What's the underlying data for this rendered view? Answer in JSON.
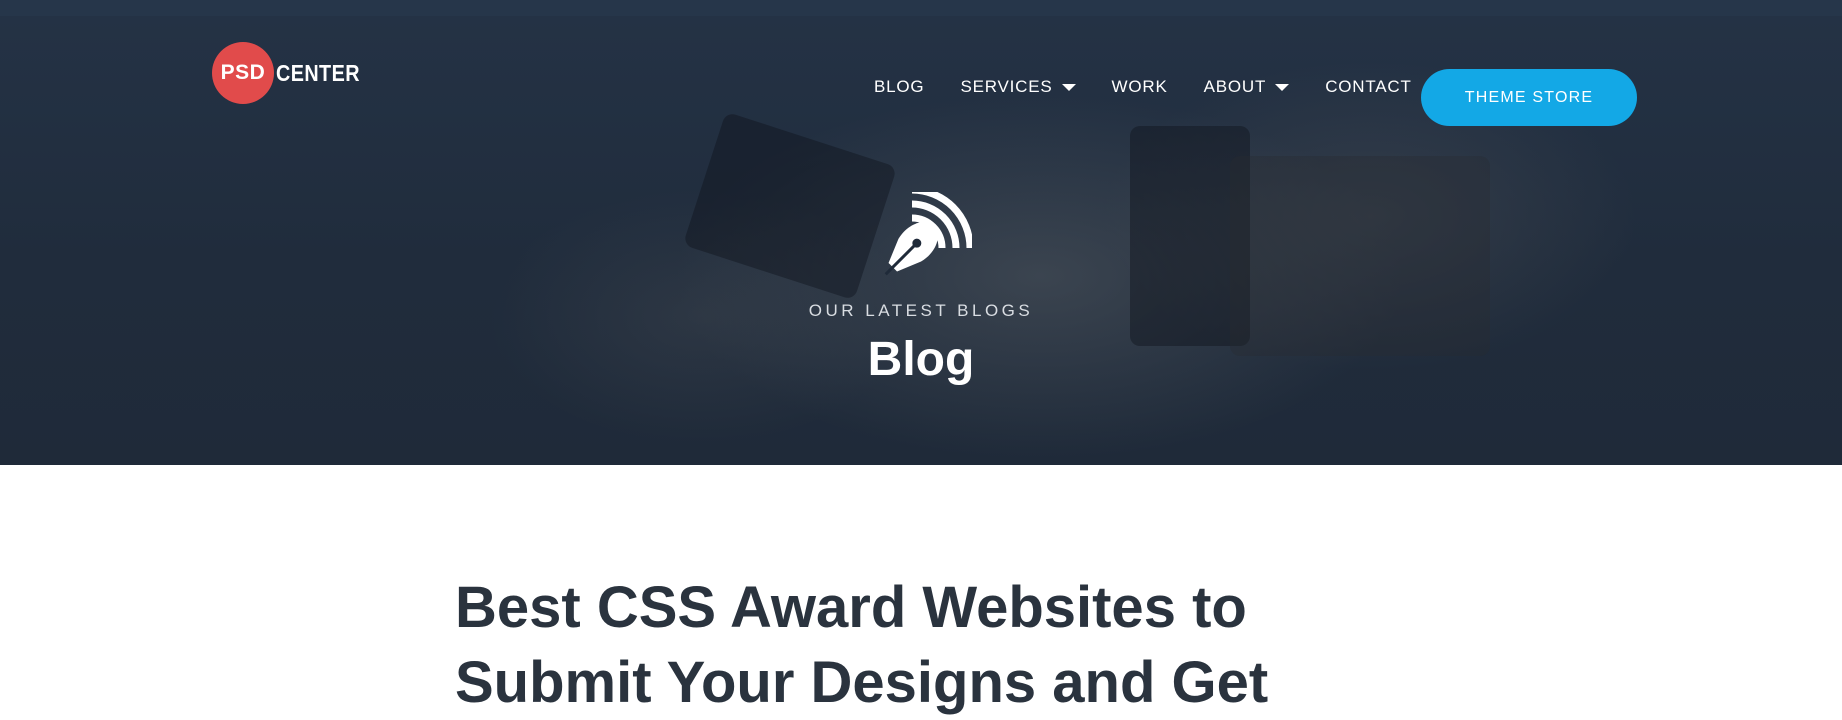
{
  "logo": {
    "badge_text": "PSD",
    "text": "CENTER",
    "badge_color": "#e14b4b"
  },
  "nav": {
    "items": [
      {
        "label": "BLOG",
        "has_dropdown": false
      },
      {
        "label": "SERVICES",
        "has_dropdown": true
      },
      {
        "label": "WORK",
        "has_dropdown": false
      },
      {
        "label": "ABOUT",
        "has_dropdown": true
      },
      {
        "label": "CONTACT",
        "has_dropdown": false
      }
    ],
    "cta_label": "THEME STORE",
    "cta_color": "#13a8e6"
  },
  "hero": {
    "icon": "pen-nib-broadcast-icon",
    "eyebrow": "OUR LATEST BLOGS",
    "title": "Blog"
  },
  "post": {
    "title": "Best CSS Award Websites to Submit Your Designs and Get"
  }
}
